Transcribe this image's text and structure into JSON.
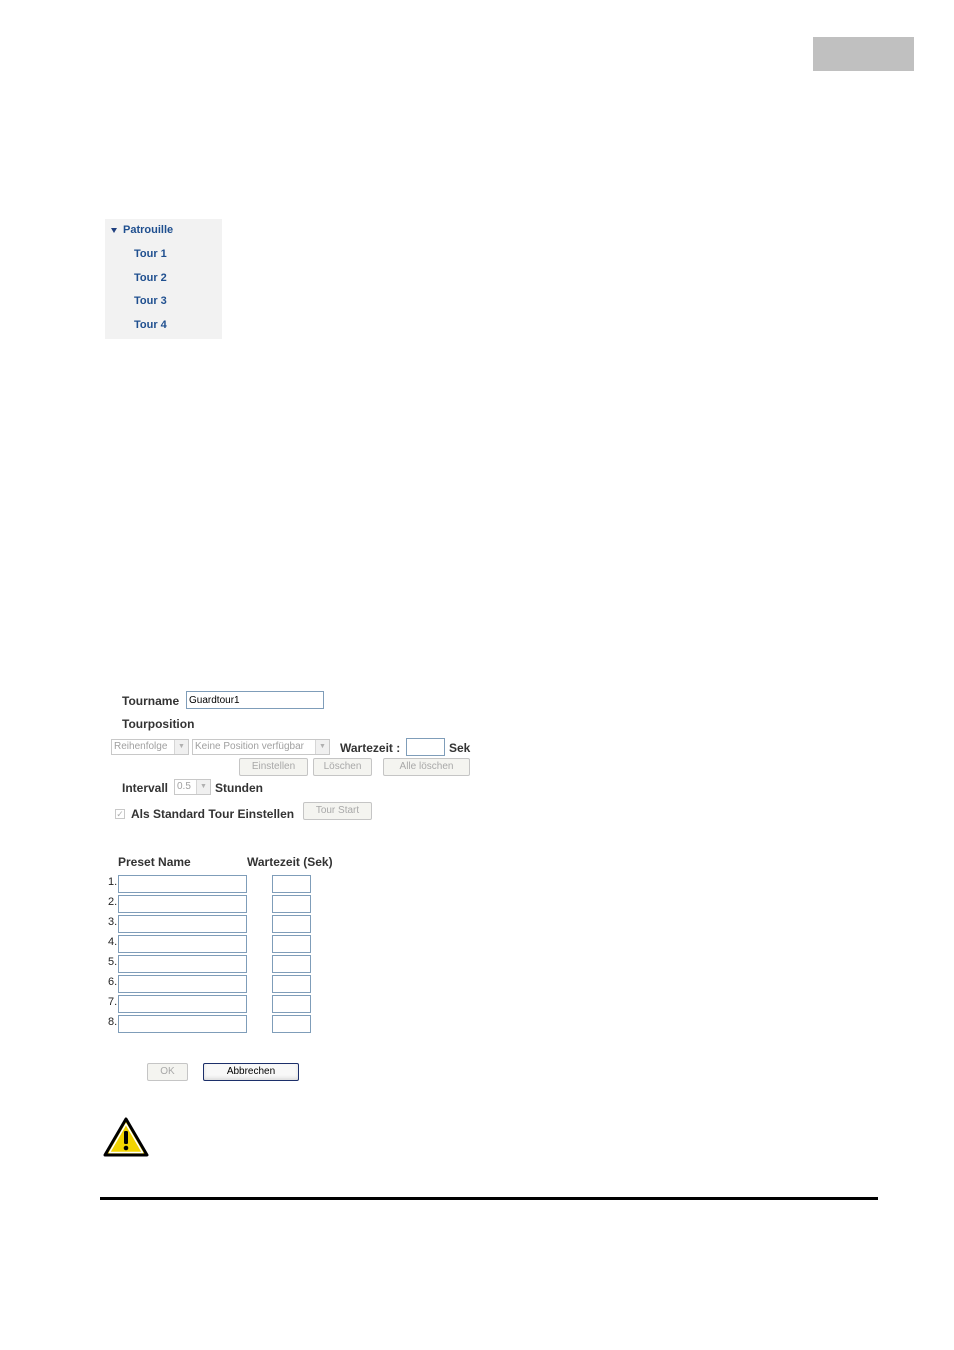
{
  "menu": {
    "heading": "Patrouille",
    "items": [
      "Tour 1",
      "Tour 2",
      "Tour 3",
      "Tour 4"
    ]
  },
  "form": {
    "tourname_label": "Tourname",
    "tourname_value": "Guardtour1",
    "tourposition_label": "Tourposition",
    "order_select": "Reihenfolge",
    "position_select": "Keine Position verfügbar",
    "wait_label": "Wartezeit :",
    "wait_unit": "Sek",
    "btn_set": "Einstellen",
    "btn_delete": "Löschen",
    "btn_delete_all": "Alle löschen",
    "interval_label": "Intervall",
    "interval_value": "0.5",
    "interval_unit": "Stunden",
    "default_tour_label": "Als Standard Tour Einstellen",
    "btn_tour_start": "Tour Start",
    "col_preset": "Preset Name",
    "col_wait": "Wartezeit (Sek)",
    "rows": [
      "1.",
      "2.",
      "3.",
      "4.",
      "5.",
      "6.",
      "7.",
      "8."
    ],
    "btn_ok": "OK",
    "btn_cancel": "Abbrechen"
  },
  "icons": {
    "warning": "warning-triangle-icon"
  },
  "colors": {
    "menu_text": "#1f4f8f",
    "menu_bg": "#f2f2f2",
    "warning_yellow": "#f2d400"
  }
}
